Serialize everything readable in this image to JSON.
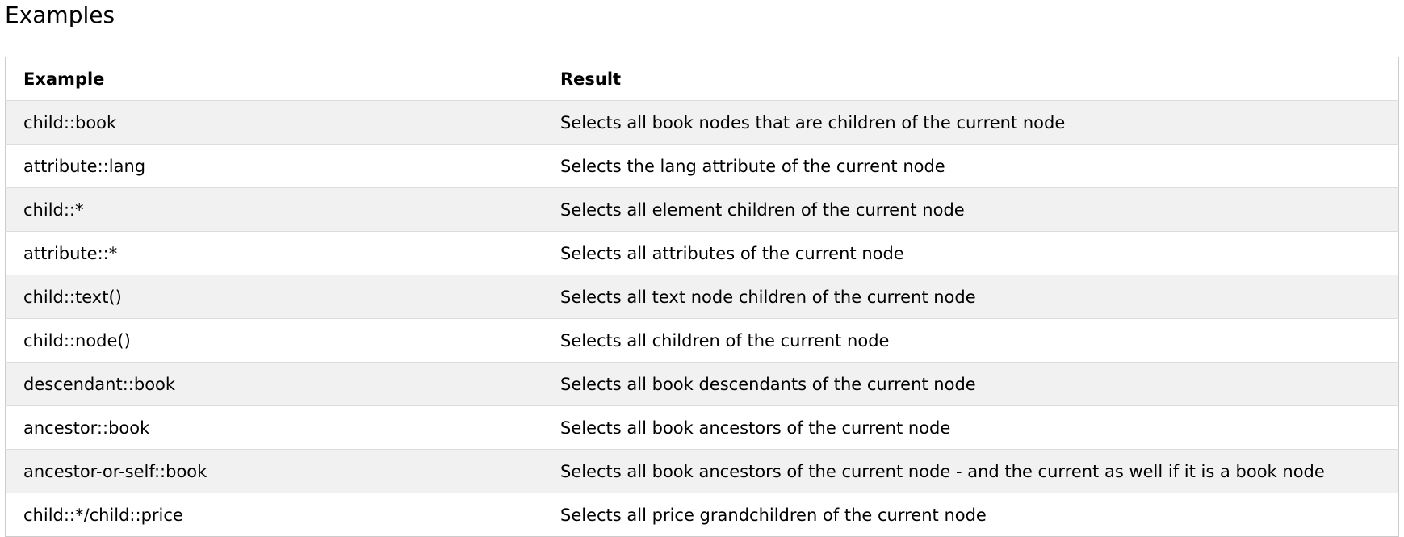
{
  "section": {
    "title": "Examples"
  },
  "table": {
    "headers": {
      "example": "Example",
      "result": "Result"
    },
    "rows": [
      {
        "example": "child::book",
        "result": "Selects all book nodes that are children of the current node"
      },
      {
        "example": "attribute::lang",
        "result": "Selects the lang attribute of the current node"
      },
      {
        "example": "child::*",
        "result": "Selects all element children of the current node"
      },
      {
        "example": "attribute::*",
        "result": "Selects all attributes of the current node"
      },
      {
        "example": "child::text()",
        "result": "Selects all text node children of the current node"
      },
      {
        "example": "child::node()",
        "result": "Selects all children of the current node"
      },
      {
        "example": "descendant::book",
        "result": "Selects all book descendants of the current node"
      },
      {
        "example": "ancestor::book",
        "result": "Selects all book ancestors of the current node"
      },
      {
        "example": "ancestor-or-self::book",
        "result": "Selects all book ancestors of the current node - and the current as well if it is a book node"
      },
      {
        "example": "child::*/child::price",
        "result": "Selects all price grandchildren of the current node"
      }
    ]
  },
  "colors": {
    "row_stripe": "#f1f1f1",
    "row_plain": "#ffffff",
    "border": "#cccccc"
  }
}
